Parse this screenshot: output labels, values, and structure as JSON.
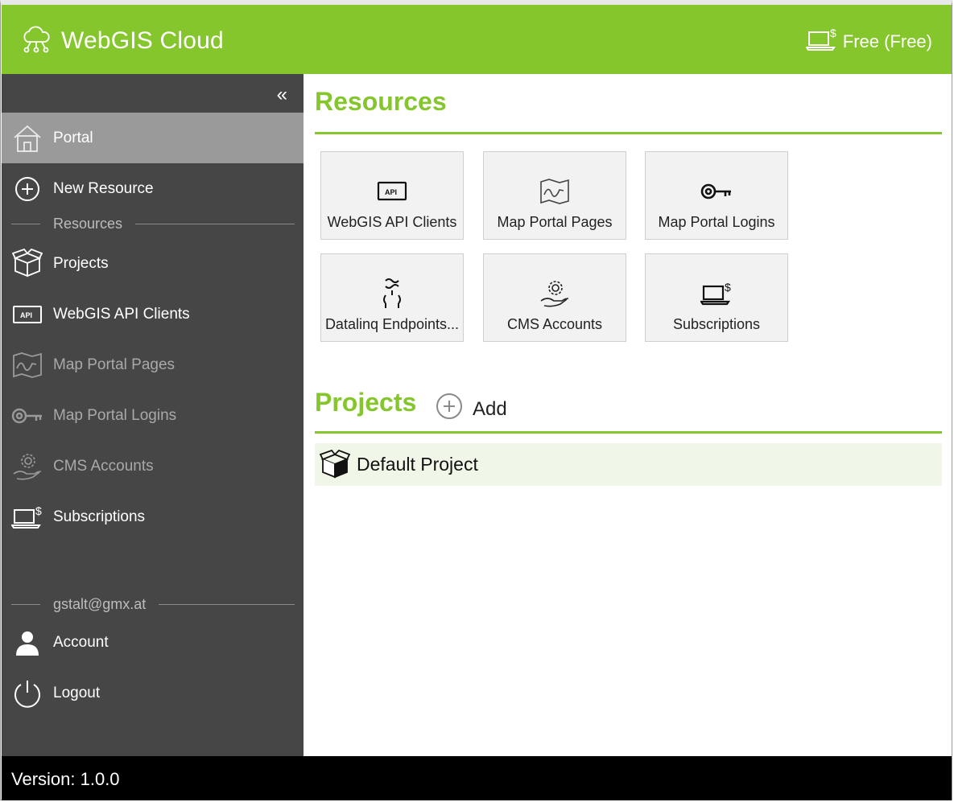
{
  "header": {
    "title": "WebGIS Cloud",
    "plan": "Free (Free)"
  },
  "sidebar": {
    "collapse": "«",
    "portal": "Portal",
    "new_resource": "New Resource",
    "resources_section": "Resources",
    "items": [
      {
        "label": "Projects",
        "icon": "box-icon",
        "dim": false
      },
      {
        "label": "WebGIS API Clients",
        "icon": "api-icon",
        "dim": false
      },
      {
        "label": "Map Portal Pages",
        "icon": "map-icon",
        "dim": true
      },
      {
        "label": "Map Portal Logins",
        "icon": "key-icon",
        "dim": true
      },
      {
        "label": "CMS Accounts",
        "icon": "gear-hand-icon",
        "dim": true
      },
      {
        "label": "Subscriptions",
        "icon": "laptop-dollar-icon",
        "dim": false
      }
    ],
    "user_section": "gstalt@gmx.at",
    "account": "Account",
    "logout": "Logout"
  },
  "main": {
    "resources_title": "Resources",
    "tiles": [
      {
        "label": "WebGIS API Clients",
        "icon": "api-icon"
      },
      {
        "label": "Map Portal Pages",
        "icon": "map-icon"
      },
      {
        "label": "Map Portal Logins",
        "icon": "key-icon"
      },
      {
        "label": "Datalinq Endpoints...",
        "icon": "datalinq-icon"
      },
      {
        "label": "CMS Accounts",
        "icon": "gear-hand-icon"
      },
      {
        "label": "Subscriptions",
        "icon": "laptop-dollar-icon"
      }
    ],
    "projects_title": "Projects",
    "add_label": "Add",
    "projects": [
      {
        "name": "Default Project"
      }
    ]
  },
  "footer": {
    "version": "Version: 1.0.0"
  },
  "colors": {
    "accent": "#84c62b",
    "sidebar": "#464646",
    "active": "#9a9a9a"
  }
}
